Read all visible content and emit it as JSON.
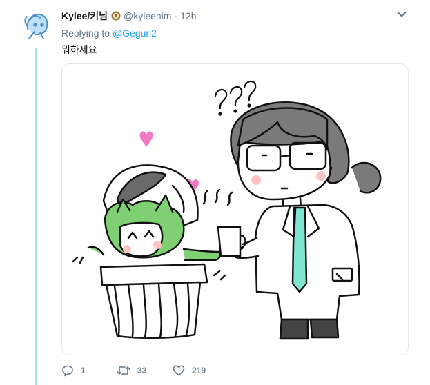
{
  "tweet": {
    "author_name": "Kylee/키님",
    "author_handle": "@kyleenim",
    "separator": "·",
    "time": "12h",
    "replying_prefix": "Replying to",
    "replying_to": "@Geguri2",
    "text": "뭐하세요",
    "image": {
      "sound_text": "??? ",
      "kind": "drawing"
    },
    "actions": {
      "reply_count": "1",
      "retweet_count": "33",
      "like_count": "219"
    }
  },
  "colors": {
    "thread_line": "#9ee8da",
    "link": "#1da1f2",
    "muted": "#657786",
    "heart_pink": "#f079c4",
    "frog_green": "#7fcf73",
    "tie_mint": "#7fe6d0"
  },
  "icons": [
    "avatar-icon",
    "badge-icon",
    "chevron-down-icon",
    "reply-icon",
    "retweet-icon",
    "like-icon"
  ]
}
